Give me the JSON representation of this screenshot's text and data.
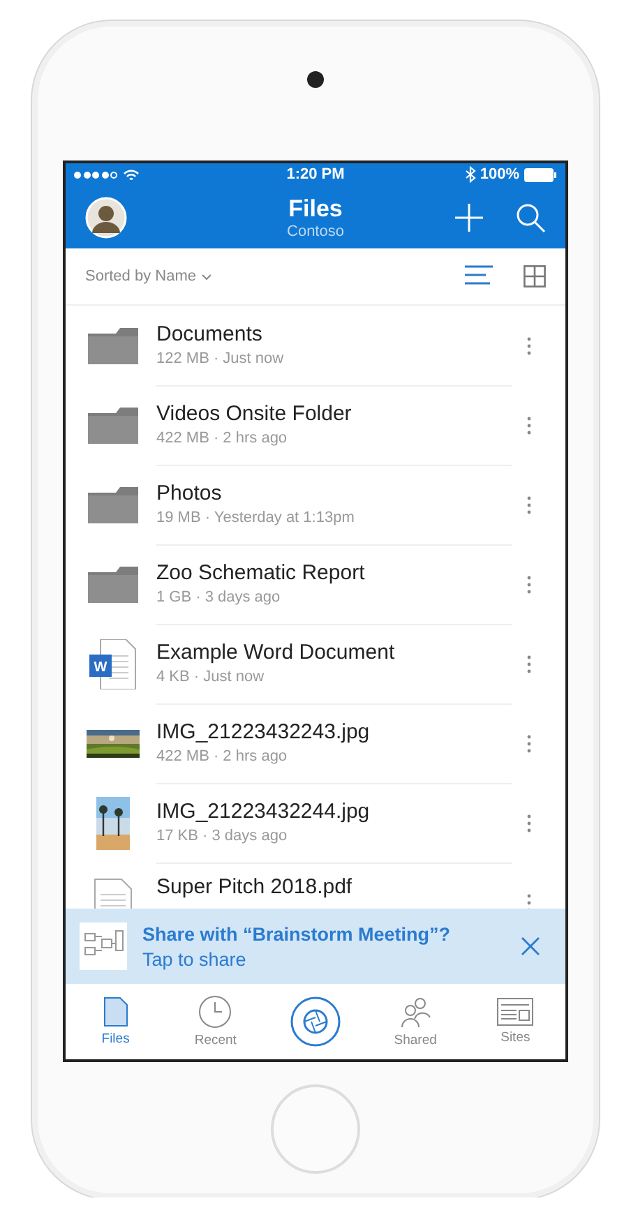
{
  "status_bar": {
    "time": "1:20 PM",
    "battery": "100%"
  },
  "header": {
    "title": "Files",
    "subtitle": "Contoso"
  },
  "toolbar": {
    "sort_label": "Sorted by Name",
    "views": [
      {
        "kind": "list",
        "selected": true
      },
      {
        "kind": "grid",
        "selected": false
      }
    ]
  },
  "files": [
    {
      "kind": "folder",
      "name": "Documents",
      "meta": "122 MB · Just now"
    },
    {
      "kind": "folder",
      "name": "Videos Onsite Folder",
      "meta": "422 MB · 2 hrs ago"
    },
    {
      "kind": "folder",
      "name": "Photos",
      "meta": "19 MB · Yesterday at 1:13pm"
    },
    {
      "kind": "folder",
      "name": "Zoo Schematic Report",
      "meta": "1 GB · 3 days ago"
    },
    {
      "kind": "word",
      "name": "Example Word Document",
      "meta": "4 KB · Just now",
      "badge": "W"
    },
    {
      "kind": "landscape",
      "name": "IMG_21223432243.jpg",
      "meta": "422 MB · 2 hrs ago"
    },
    {
      "kind": "portrait",
      "name": "IMG_21223432244.jpg",
      "meta": "17 KB · 3 days ago"
    },
    {
      "kind": "pdf",
      "name": "Super Pitch 2018.pdf"
    }
  ],
  "banner": {
    "title": "Share with “Brainstorm Meeting”?",
    "action": "Tap to share"
  },
  "tabs": [
    {
      "kind": "files",
      "label": "Files",
      "selected": true
    },
    {
      "kind": "recent",
      "label": "Recent",
      "selected": false
    },
    {
      "kind": "shared",
      "label": "Shared",
      "selected": false
    },
    {
      "kind": "sites",
      "label": "Sites",
      "selected": false
    }
  ]
}
